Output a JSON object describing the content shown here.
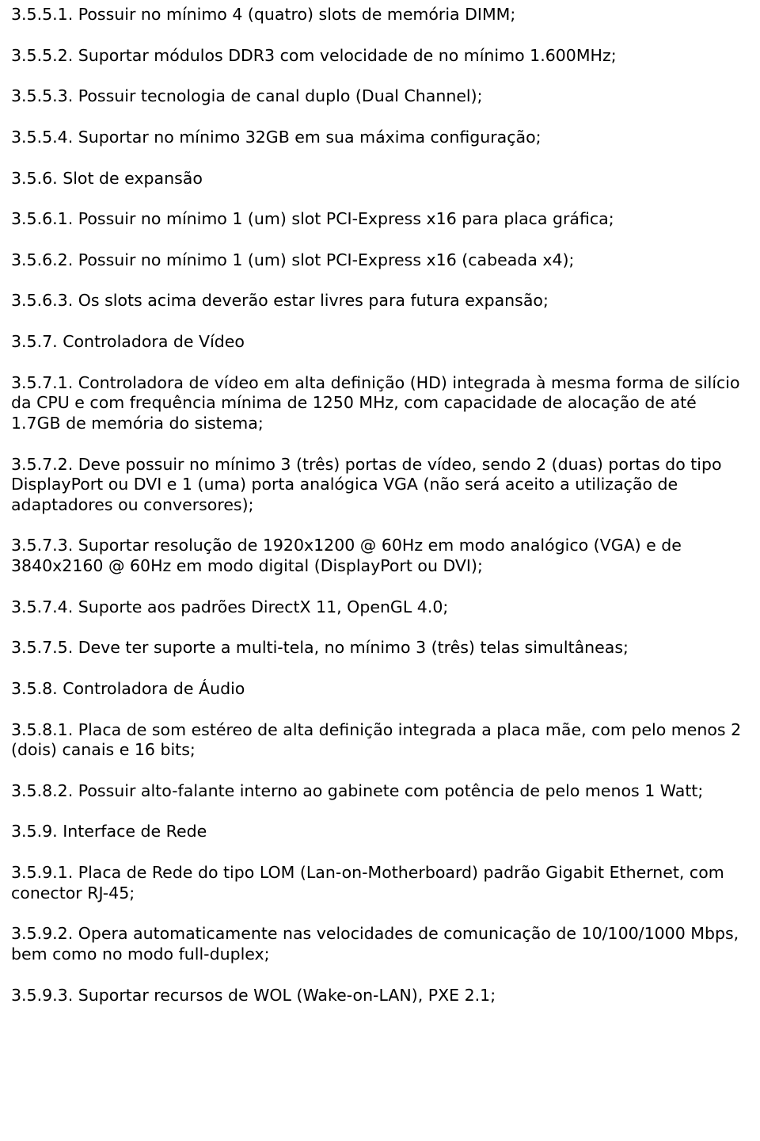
{
  "p": [
    "3.5.5.1. Possuir no mínimo 4 (quatro) slots de memória DIMM;",
    "3.5.5.2. Suportar módulos DDR3 com velocidade de no mínimo 1.600MHz;",
    "3.5.5.3. Possuir tecnologia de canal duplo (Dual Channel);",
    "3.5.5.4. Suportar no mínimo 32GB em sua máxima configuração;",
    "3.5.6. Slot de expansão",
    "3.5.6.1. Possuir no mínimo 1 (um) slot PCI-Express x16 para placa gráfica;",
    "3.5.6.2. Possuir no mínimo 1 (um) slot PCI-Express x16 (cabeada x4);",
    "3.5.6.3. Os slots acima deverão estar livres para futura expansão;",
    "3.5.7. Controladora de Vídeo",
    "3.5.7.1. Controladora de vídeo em alta definição (HD) integrada à mesma forma de silício da CPU e com frequência mínima de 1250 MHz, com capacidade de alocação de até 1.7GB de memória do sistema;",
    "3.5.7.2. Deve possuir no mínimo 3 (três) portas de vídeo, sendo 2 (duas) portas do tipo DisplayPort ou DVI e 1 (uma) porta analógica VGA (não será aceito a utilização de adaptadores ou conversores);",
    "3.5.7.3. Suportar resolução de 1920x1200 @ 60Hz em modo analógico (VGA) e de 3840x2160 @ 60Hz em modo digital (DisplayPort ou DVI);",
    "3.5.7.4. Suporte aos padrões DirectX 11, OpenGL 4.0;",
    "3.5.7.5. Deve ter suporte a multi-tela, no mínimo 3 (três) telas simultâneas;",
    "3.5.8. Controladora de Áudio",
    "3.5.8.1. Placa de som estéreo de alta definição integrada a placa mãe, com pelo menos 2 (dois) canais e 16 bits;",
    "3.5.8.2. Possuir alto-falante interno ao gabinete com potência de pelo menos  1 Watt;",
    "3.5.9. Interface de Rede",
    "3.5.9.1. Placa de Rede do tipo LOM (Lan-on-Motherboard) padrão Gigabit Ethernet, com conector RJ-45;",
    "3.5.9.2. Opera automaticamente nas velocidades de comunicação de 10/100/1000 Mbps, bem como no modo full-duplex;",
    "3.5.9.3. Suportar recursos de WOL (Wake-on-LAN), PXE 2.1;"
  ],
  "justify_indices": [
    16
  ]
}
